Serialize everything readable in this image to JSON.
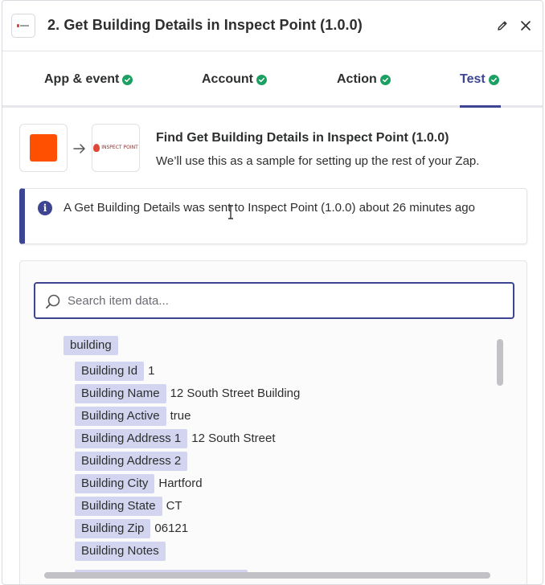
{
  "header": {
    "title": "2. Get Building Details in Inspect Point (1.0.0)",
    "app_icon": "inspect-point-logo",
    "edit_icon": "pencil-icon",
    "close_icon": "close-icon"
  },
  "tabs": [
    {
      "label": "App & event",
      "complete": true
    },
    {
      "label": "Account",
      "complete": true
    },
    {
      "label": "Action",
      "complete": true
    },
    {
      "label": "Test",
      "complete": true,
      "active": true
    }
  ],
  "step": {
    "trigger_icon": "orange-square",
    "action_icon_text": "INSPECT POINT",
    "title": "Find Get Building Details in Inspect Point (1.0.0)",
    "subtitle": "We’ll use this as a sample for setting up the rest of your Zap."
  },
  "alert": {
    "icon": "info-icon",
    "message": "A Get Building Details was sent to Inspect Point (1.0.0) about 26 minutes ago"
  },
  "search": {
    "placeholder": "Search item data..."
  },
  "data": {
    "root_label": "building",
    "fields": [
      {
        "key": "Building Id",
        "value": "1"
      },
      {
        "key": "Building Name",
        "value": "12 South Street Building"
      },
      {
        "key": "Building Active",
        "value": "true"
      },
      {
        "key": "Building Address 1",
        "value": "12 South Street"
      },
      {
        "key": "Building Address 2",
        "value": ""
      },
      {
        "key": "Building City",
        "value": "Hartford"
      },
      {
        "key": "Building State",
        "value": "CT"
      },
      {
        "key": "Building Zip",
        "value": "06121"
      },
      {
        "key": "Building Notes",
        "value": ""
      }
    ]
  },
  "colors": {
    "accent": "#3d4592",
    "success": "#1c9f62",
    "chip": "#d3d5f0",
    "zapier_orange": "#ff4f00"
  }
}
